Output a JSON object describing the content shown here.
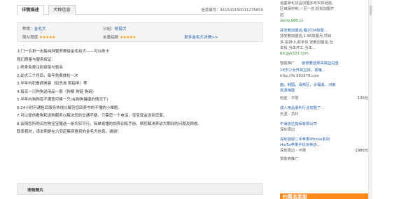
{
  "tabs": [
    {
      "label": "详情描述",
      "active": true
    },
    {
      "label": "犬种信息",
      "active": false
    }
  ],
  "info_no": "信息编号：341500150011275859",
  "attrs": {
    "breed_label": "种类：",
    "breed_value": "金毛犬",
    "group_label": "分组：",
    "group_value": "枪猎犬",
    "loyalty_label": "服从程度",
    "loyalty_stars": "★★★★★",
    "friendly_label": "友善指数",
    "friendly_stars": "★★★★★",
    "more_link": "更多金毛犬详情>>"
  },
  "description": [
    "上门一五折一出售纯种繁养赛级金毛幼犬——可以刷卡",
    "我们质量与服务保证:",
    "1.终身免费注射疫苗与驱虫",
    "2.幼犬三个月后，每年免费体检一次",
    "3.半年内犯看病美容（如洗澡 剪指甲）等",
    "4.每买一只狗狗送用品一套（狗粮 狗链 狗碗）",
    "5.半年内狗狗有不满意可换一只(在狗狗健康的情况下)",
    "6.24小时开通售后服务热线以解答您回养中的不懂的小难题。",
    "7.可以提供看狗和送狗服务以解决您的交通不便。只需您一个电话，宝宝就会送到您家。",
    "8.会随您所购买的狗宝宝赠送一册切实可行，简单易懂的饲养训练手册，帮您解决养幼犬期间的问题及顾虑。",
    "联系我时，请说明是在六安赶集网看到的金毛犬信息，谢谢！"
  ],
  "photos_header": "宠物照片",
  "sidebar": {
    "ad1_lines": [
      "追塞拿化妆品加盟多年实体经验,",
      "区域保护制,一区一店,轻松加盟开",
      "店"
    ],
    "ad1_url": "xomy.b88.cn",
    "ad2_title": "扶安散加盟店,看2014加盟...",
    "ad2_lines": [
      "扶安散加盟店,1.96加盟月,项目",
      "多,投排小,即本快,安散加盟店,当",
      "年投,当年开工,当年..."
    ],
    "ad2_url": "bd.gys321.com",
    "promo_label": "智能推广",
    "promo_link": "装修要选择高端亚进皇",
    "cbg_title": "18岁少女开高宝钱，青瑰...",
    "cbg_url": "http://fb.992878.com",
    "regions": [
      "面，韩国，清邦区，泳福溪，河南",
      "犹源梅厘"
    ],
    "item1_name": "哈密 - 不限",
    "item1_price": "130元",
    "item2_title": "成人用品暴利行业加盟了...",
    "item2_sub": "天涯 - 员村",
    "item3_title": "中海信达指保有限公司",
    "item3_sub": "深圳周边",
    "item4_title": "深圳回收二手苹果iPhone系列",
    "item4_sub1": "i4s/5s苹果手机专卖店...",
    "item4_sub2": "深圳周边 - 不限",
    "item4_price": "1080元",
    "footer_label": "赞助商推广",
    "banner_text": "扫集名胜股"
  },
  "colors": {
    "link": "#2060b0",
    "stars": "#f39800",
    "banner": "#ff8a1c"
  }
}
